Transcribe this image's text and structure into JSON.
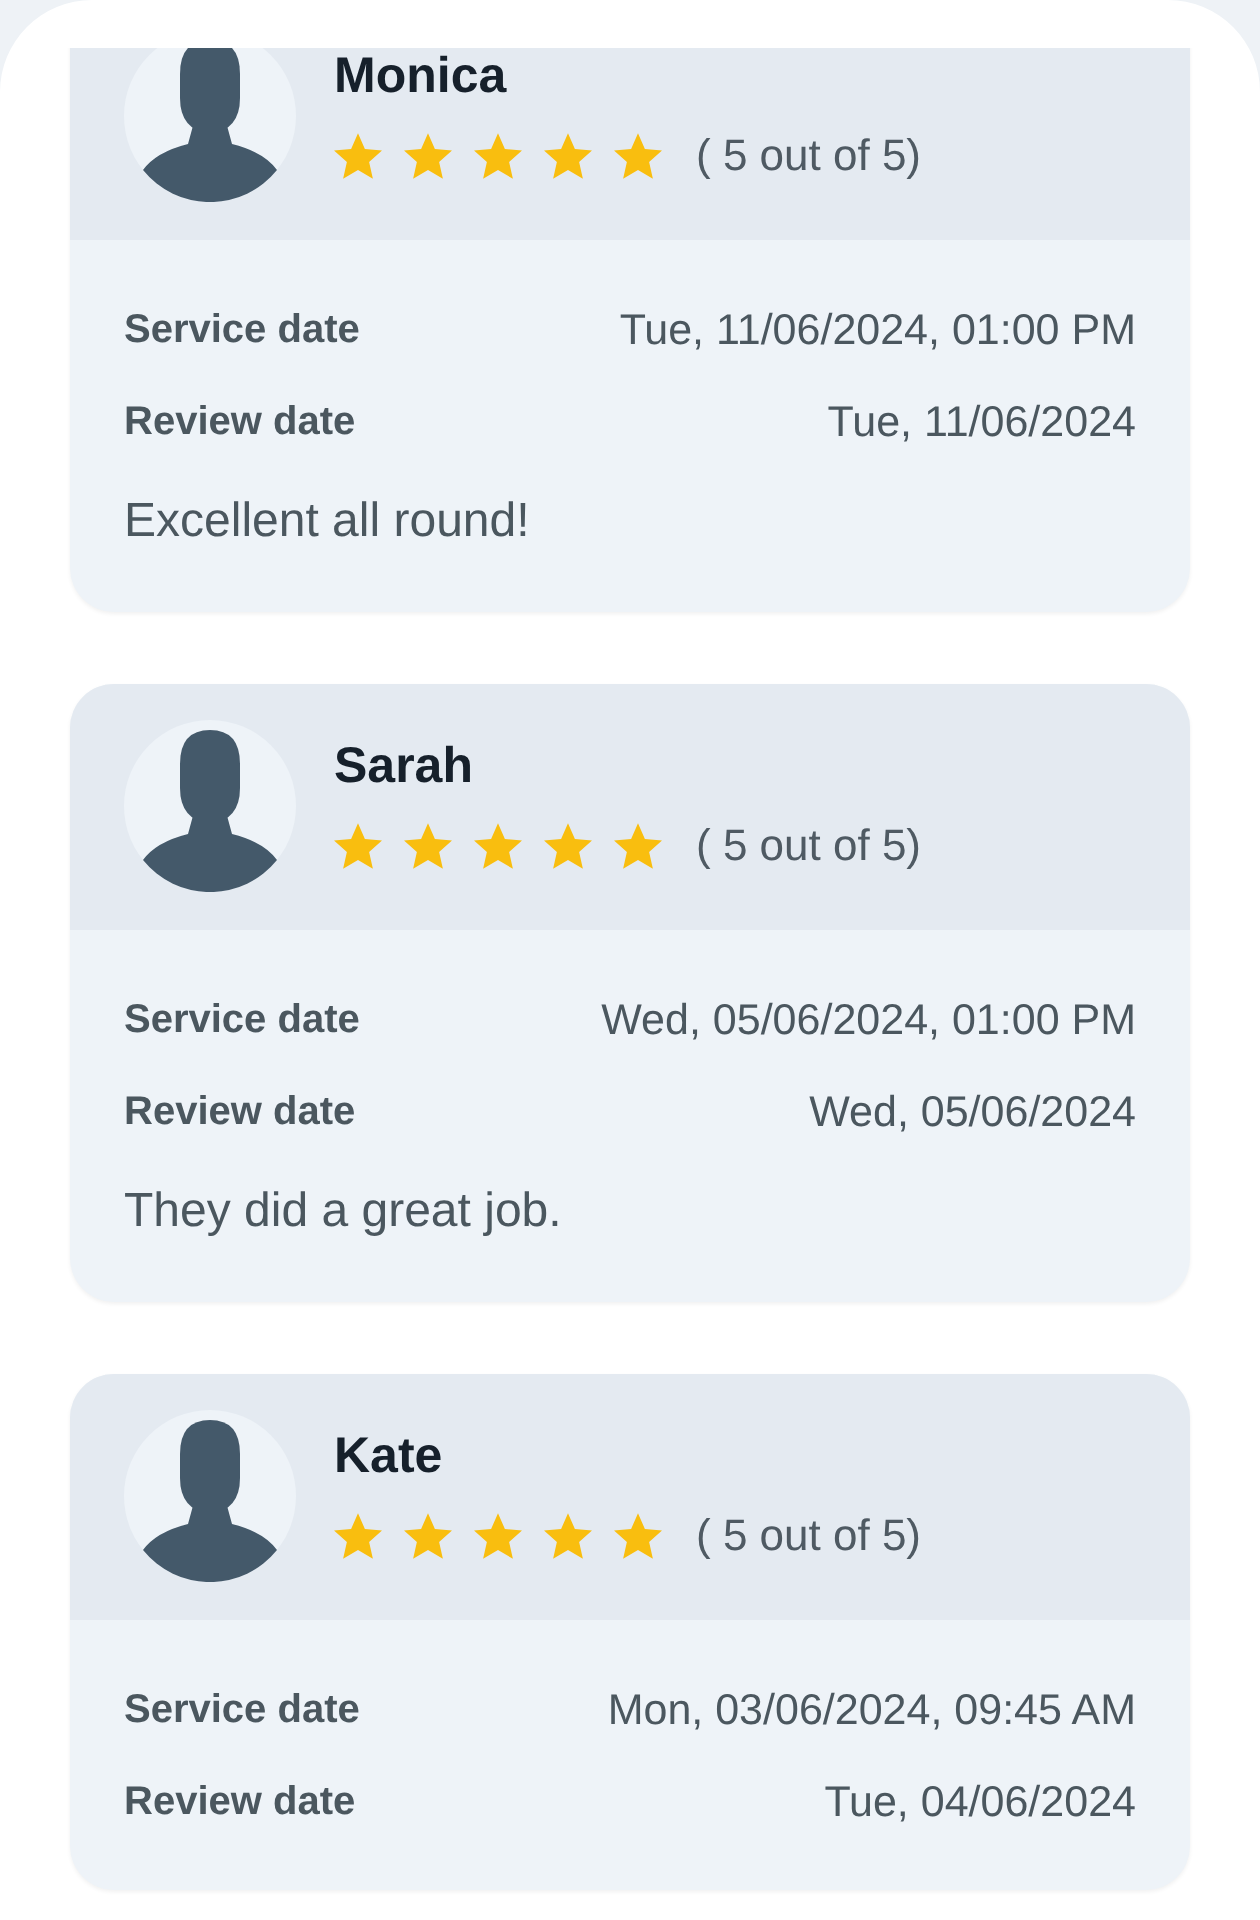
{
  "reviews": [
    {
      "name": "Monica",
      "stars": 5,
      "rating_text": "( 5 out of 5)",
      "details": [
        {
          "label": "Service date",
          "value": "Tue, 11/06/2024, 01:00 PM"
        },
        {
          "label": "Review date",
          "value": "Tue, 11/06/2024"
        }
      ],
      "comment": "Excellent all round!"
    },
    {
      "name": "Sarah",
      "stars": 5,
      "rating_text": "( 5 out of 5)",
      "details": [
        {
          "label": "Service date",
          "value": "Wed, 05/06/2024, 01:00 PM"
        },
        {
          "label": "Review date",
          "value": "Wed, 05/06/2024"
        }
      ],
      "comment": "They did a great job."
    },
    {
      "name": "Kate",
      "stars": 5,
      "rating_text": "( 5 out of 5)",
      "details": [
        {
          "label": "Service date",
          "value": "Mon, 03/06/2024, 09:45 AM"
        },
        {
          "label": "Review date",
          "value": "Tue, 04/06/2024"
        }
      ]
    }
  ]
}
